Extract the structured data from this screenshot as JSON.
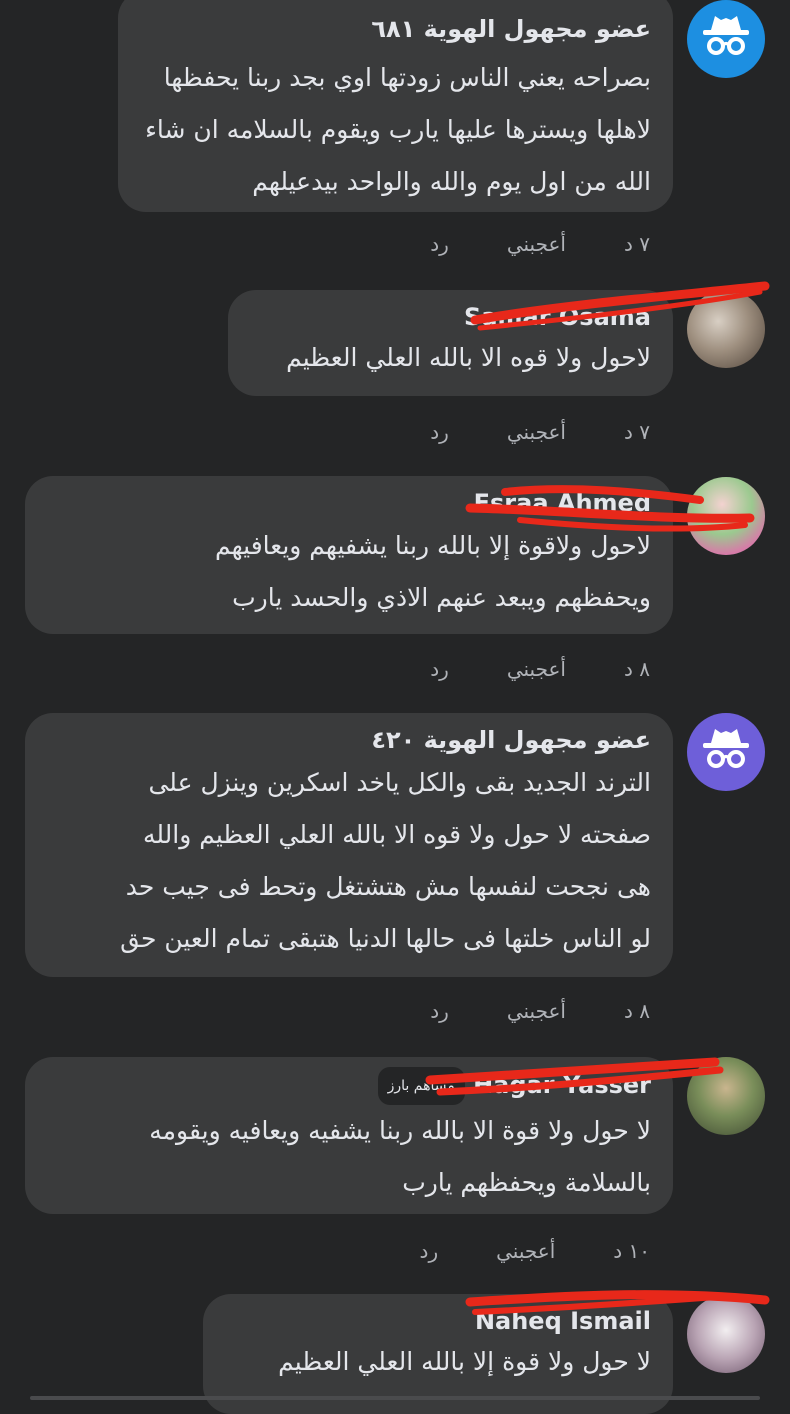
{
  "comments": [
    {
      "author": "عضو مجهول الهوية ٦٨١",
      "avatar_icon": "anonymous-incognito-icon",
      "avatar_color": "#1d8fe1",
      "lines": [
        "بصراحه يعني الناس زودتها اوي بجد ربنا يحفظها",
        "لاهلها ويسترها عليها يارب ويقوم بالسلامه ان شاء",
        "الله من اول يوم والله والواحد بيدعيلهم"
      ],
      "time": "٧ د",
      "like": "أعجبني",
      "reply": "رد"
    },
    {
      "author": "Samar Osama",
      "lines": [
        "لاحول ولا قوه الا بالله العلي العظيم"
      ],
      "time": "٧ د",
      "like": "أعجبني",
      "reply": "رد"
    },
    {
      "author": "Esraa Ahmed",
      "lines": [
        "لاحول ولاقوة إلا بالله ربنا يشفيهم ويعافيهم",
        "ويحفظهم ويبعد عنهم الاذي والحسد يارب"
      ],
      "time": "٨ د",
      "like": "أعجبني",
      "reply": "رد"
    },
    {
      "author": "عضو مجهول الهوية ٤٢٠",
      "avatar_icon": "anonymous-incognito-icon",
      "avatar_color": "#6e5fd9",
      "lines": [
        "الترند الجديد  بقى والكل ياخد اسكرين وينزل على",
        "صفحته لا حول ولا قوه الا بالله العلي العظيم والله",
        "هى نجحت لنفسها مش هتشتغل وتحط فى جيب حد",
        "لو الناس خلتها فى حالها الدنيا هتبقى تمام العين حق"
      ],
      "time": "٨ د",
      "like": "أعجبني",
      "reply": "رد"
    },
    {
      "author": "Hagar Yasser",
      "badge": "مساهم بارز",
      "lines": [
        "لا حول ولا قوة الا بالله ربنا يشفيه ويعافيه ويقومه",
        "بالسلامة ويحفظهم يارب"
      ],
      "time": "١٠ د",
      "like": "أعجبني",
      "reply": "رد"
    },
    {
      "author": "Naheq Ismail",
      "lines": [
        "لا حول  ولا قوة إلا بالله العلي العظيم"
      ]
    }
  ],
  "colors": {
    "background": "#242526",
    "bubble": "#3a3b3c",
    "text": "#e4e6eb",
    "muted": "#b0b3b8",
    "redaction": "#e8281a"
  }
}
